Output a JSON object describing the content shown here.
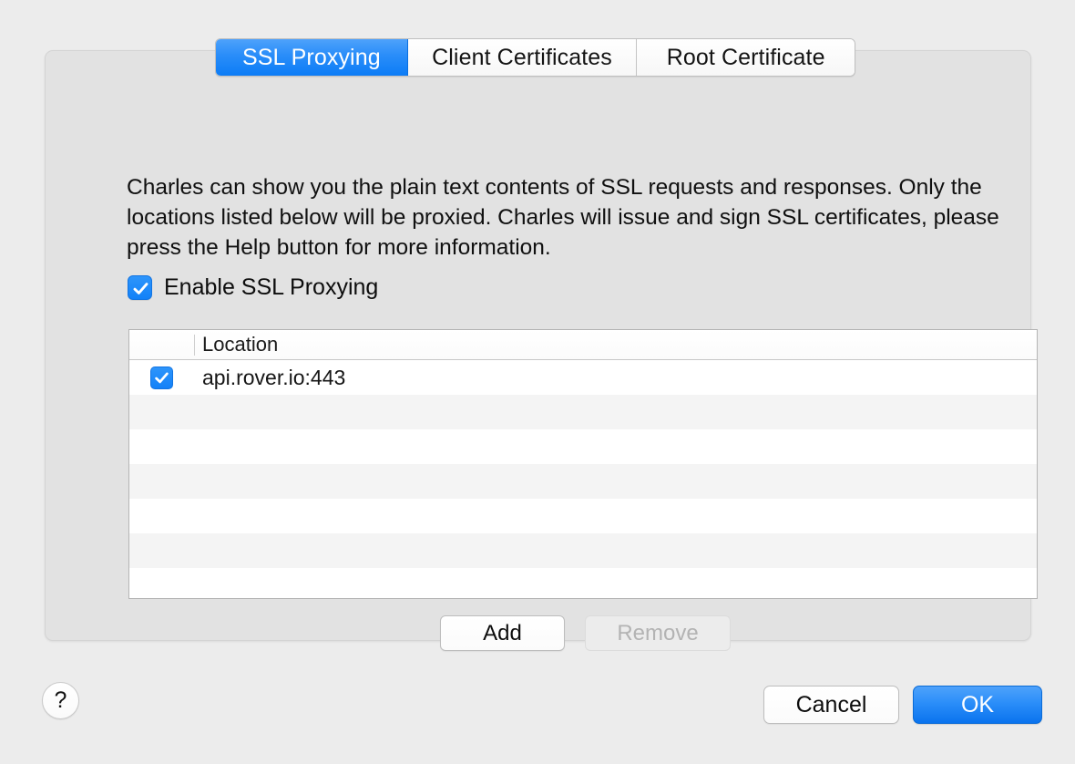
{
  "tabs": [
    {
      "label": "SSL Proxying",
      "active": true
    },
    {
      "label": "Client Certificates",
      "active": false
    },
    {
      "label": "Root Certificate",
      "active": false
    }
  ],
  "description": "Charles can show you the plain text contents of SSL requests and responses. Only the locations listed below will be proxied. Charles will issue and sign SSL certificates, please press the Help button for more information.",
  "enable_checkbox": {
    "label": "Enable SSL Proxying",
    "checked": true
  },
  "table": {
    "columns": [
      {
        "key": "check",
        "label": ""
      },
      {
        "key": "location",
        "label": "Location"
      }
    ],
    "rows": [
      {
        "checked": true,
        "location": "api.rover.io:443"
      },
      {
        "checked": false,
        "location": ""
      },
      {
        "checked": false,
        "location": ""
      },
      {
        "checked": false,
        "location": ""
      },
      {
        "checked": false,
        "location": ""
      },
      {
        "checked": false,
        "location": ""
      },
      {
        "checked": false,
        "location": ""
      }
    ]
  },
  "list_actions": {
    "add_label": "Add",
    "remove_label": "Remove",
    "remove_disabled": true
  },
  "help_button": {
    "label": "?",
    "icon": "question-mark-icon"
  },
  "dialog_actions": {
    "cancel_label": "Cancel",
    "ok_label": "OK"
  },
  "colors": {
    "accent_blue": "#1281f8",
    "page_background": "#ececec",
    "panel_background": "#e2e2e2",
    "row_alt": "#f4f4f4",
    "disabled_text": "#b3b3b3"
  }
}
